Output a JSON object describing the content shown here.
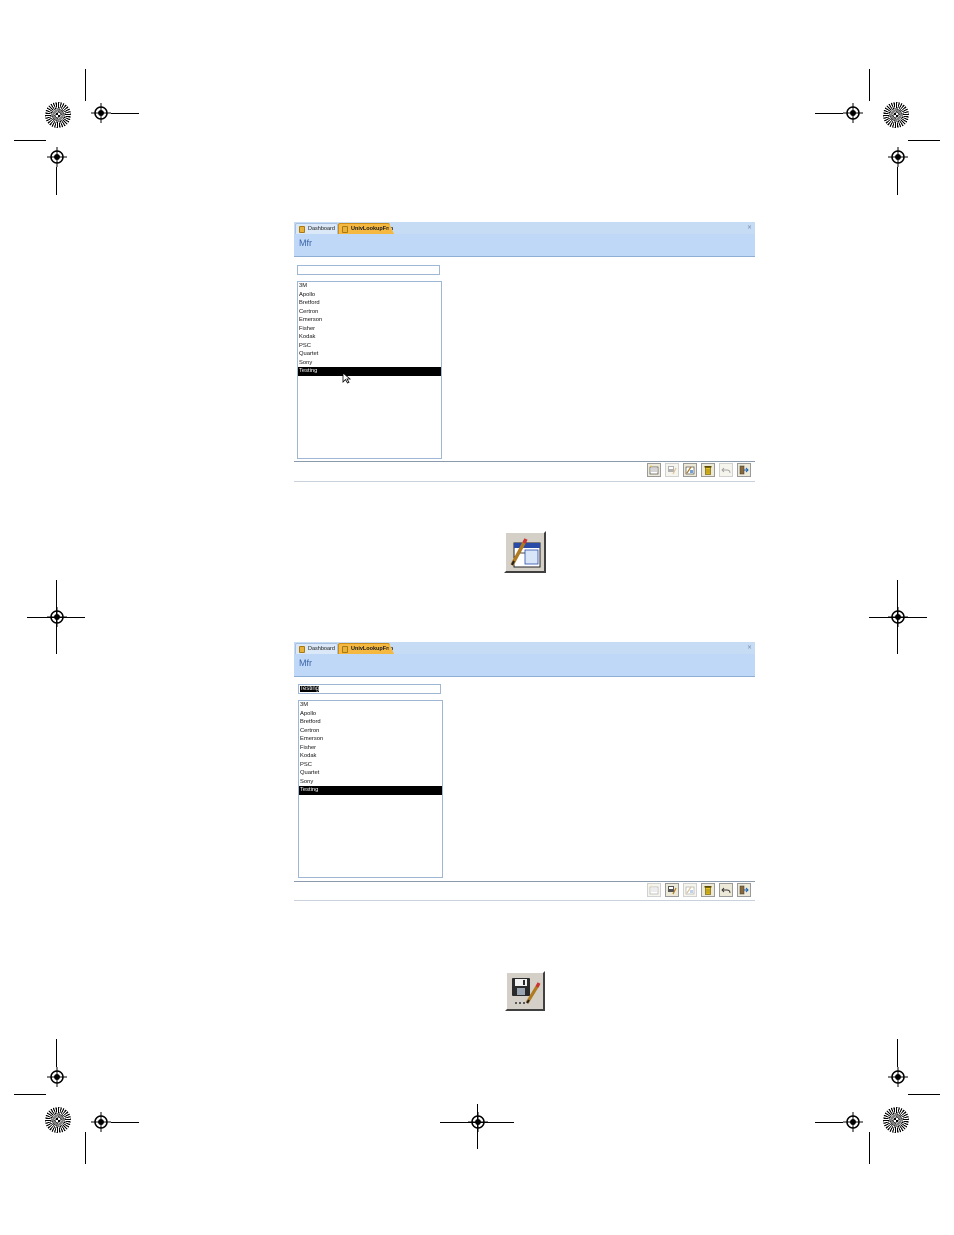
{
  "screenshot_1": {
    "tabs": [
      {
        "label": "Dashboard",
        "active": false
      },
      {
        "label": "UnivLookupFrm",
        "active": true
      }
    ],
    "close_label": "×",
    "header_title": "Mfr",
    "search_value": "",
    "list_items": [
      "3M",
      "Apollo",
      "Bretford",
      "Certron",
      "Emerson",
      "Fisher",
      "Kodak",
      "PSC",
      "Quartet",
      "Sony",
      "Testing"
    ],
    "selected_item": "Testing",
    "toolbar_buttons": [
      {
        "icon": "new-record-icon",
        "enabled": true
      },
      {
        "icon": "save-record-icon",
        "enabled": false
      },
      {
        "icon": "edit-record-icon",
        "enabled": true
      },
      {
        "icon": "delete-record-icon",
        "enabled": true
      },
      {
        "icon": "undo-icon",
        "enabled": false
      },
      {
        "icon": "exit-icon",
        "enabled": true
      }
    ]
  },
  "icon_callout_1": {
    "icon": "edit-record-icon"
  },
  "screenshot_2": {
    "tabs": [
      {
        "label": "Dashboard",
        "active": false
      },
      {
        "label": "UnivLookupFrm",
        "active": true
      }
    ],
    "close_label": "×",
    "header_title": "Mfr",
    "search_value": "Testing",
    "list_items": [
      "3M",
      "Apollo",
      "Bretford",
      "Certron",
      "Emerson",
      "Fisher",
      "Kodak",
      "PSC",
      "Quartet",
      "Sony",
      "Testing"
    ],
    "selected_item": "Testing",
    "toolbar_buttons": [
      {
        "icon": "new-record-icon",
        "enabled": false
      },
      {
        "icon": "save-record-icon",
        "enabled": true
      },
      {
        "icon": "edit-record-icon",
        "enabled": false
      },
      {
        "icon": "delete-record-icon",
        "enabled": true
      },
      {
        "icon": "undo-icon",
        "enabled": true
      },
      {
        "icon": "exit-icon",
        "enabled": true
      }
    ]
  },
  "icon_callout_2": {
    "icon": "save-record-icon"
  },
  "colors": {
    "tab_active": "#f5b840",
    "header_bg": "#bfd8f7",
    "header_text": "#3a64a8",
    "selection_bg": "#000000"
  }
}
